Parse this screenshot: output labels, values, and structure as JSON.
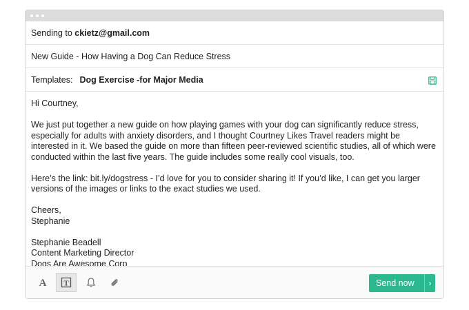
{
  "recipient": {
    "prefix": "Sending to",
    "email": "ckietz@gmail.com"
  },
  "subject": "New Guide - How Having a Dog Can Reduce Stress",
  "templates": {
    "label": "Templates:",
    "selected": "Dog Exercise -for Major Media"
  },
  "body": {
    "greeting": "Hi Courtney,",
    "paragraph1": "We just put together a new guide on how playing games with your dog can significantly reduce stress, especially for adults with anxiety disorders, and I thought Courtney Likes Travel readers might be interested in it. We based the guide on more than fifteen peer-reviewed scientific studies, all of which were conducted within the last five years. The guide includes some really cool visuals, too.",
    "paragraph2": "Here’s the link: bit.ly/dogstress - I’d love for you to consider sharing it! If you’d like, I can get you larger versions of the images or links to the exact studies we used.",
    "signoff_line1": "Cheers,",
    "signoff_line2": "Stephanie",
    "sig_name": "Stephanie Beadell",
    "sig_title": "Content Marketing Director",
    "sig_company": "Dogs Are Awesome Corp"
  },
  "toolbar": {
    "icons": [
      "font-icon",
      "template-icon",
      "bell-icon",
      "paperclip-icon"
    ],
    "send_label": "Send now",
    "send_arrow": "›"
  },
  "colors": {
    "accent": "#2bb98f",
    "save_icon": "#2bb98f"
  }
}
